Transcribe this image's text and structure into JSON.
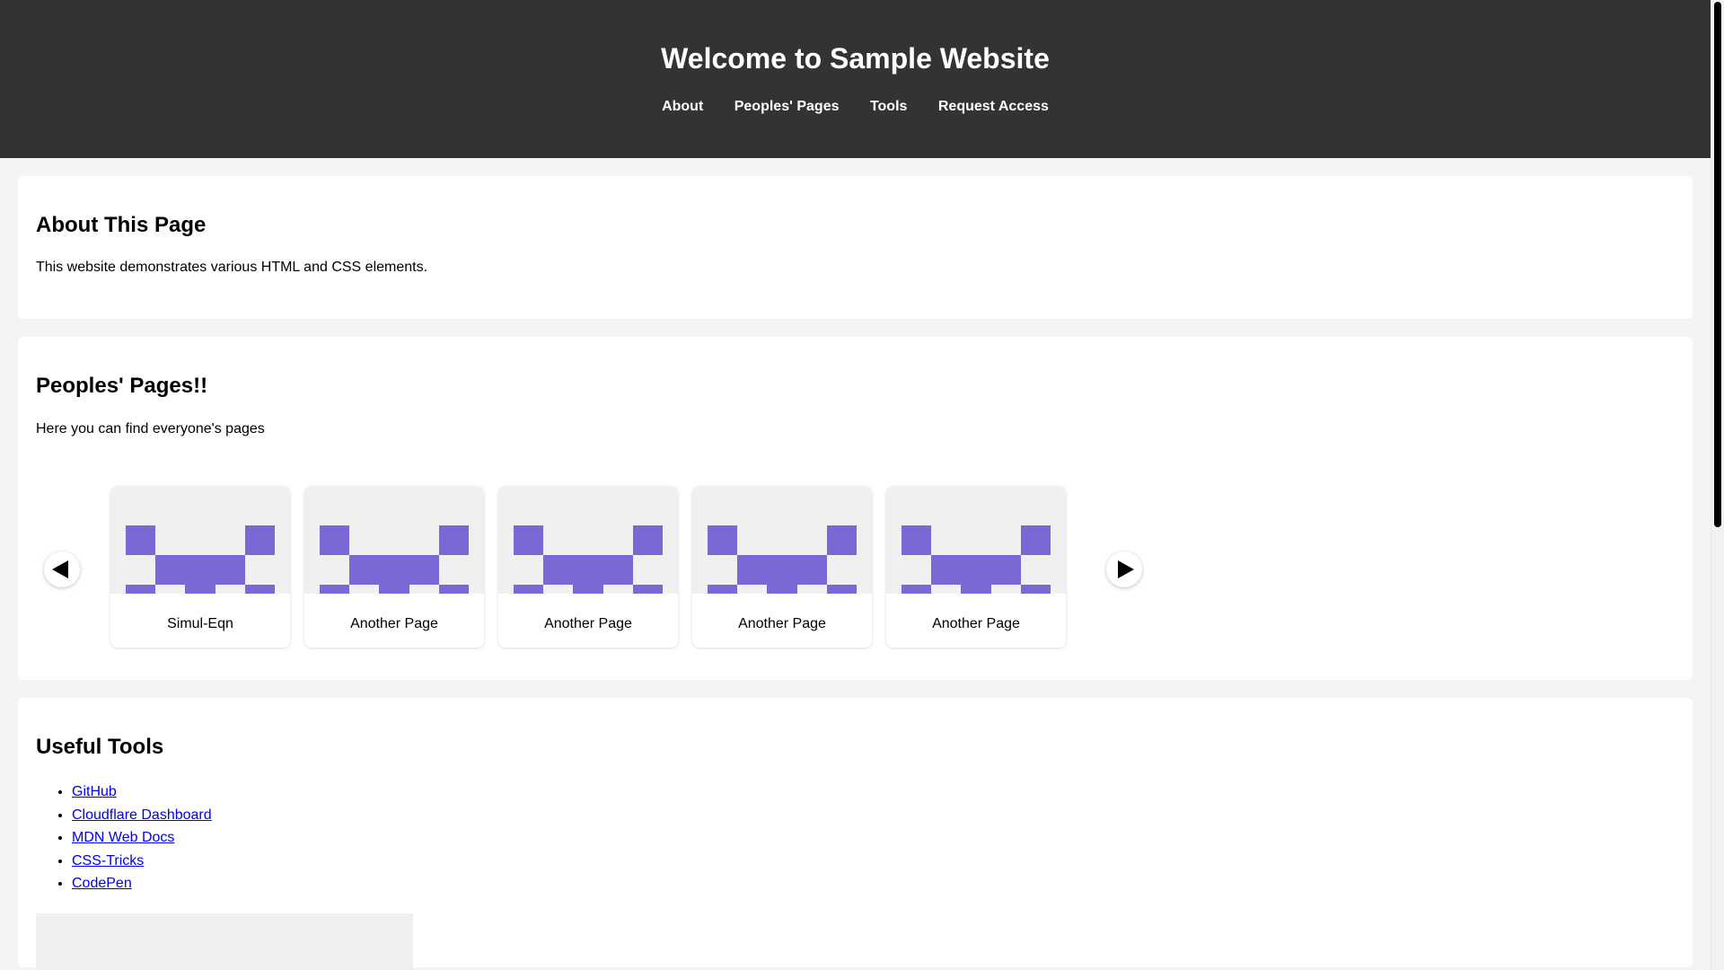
{
  "header": {
    "title": "Welcome to Sample Website",
    "nav": [
      "About",
      "Peoples' Pages",
      "Tools",
      "Request Access"
    ]
  },
  "about": {
    "heading": "About This Page",
    "text": "This website demonstrates various HTML and CSS elements."
  },
  "people": {
    "heading": "Peoples' Pages!!",
    "text": "Here you can find everyone's pages",
    "tiles": [
      "Simul-Eqn",
      "Another Page",
      "Another Page",
      "Another Page",
      "Another Page"
    ]
  },
  "tools": {
    "heading": "Useful Tools",
    "links": [
      "GitHub",
      "Cloudflare Dashboard",
      "MDN Web Docs",
      "CSS-Tricks",
      "CodePen"
    ]
  },
  "icons": {
    "prev": "arrow-left-icon",
    "next": "arrow-right-icon"
  },
  "colors": {
    "header_bg": "#333333",
    "identicon": "#7b68d4",
    "link": "#0000ee"
  }
}
